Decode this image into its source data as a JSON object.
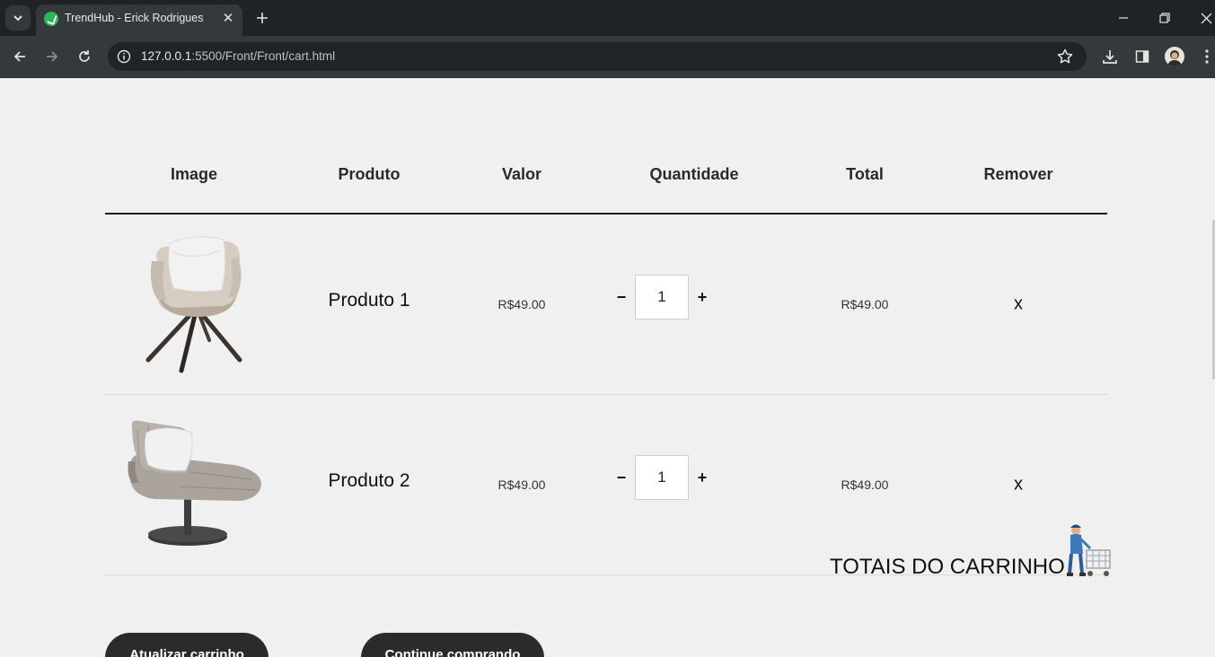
{
  "browser": {
    "tab_title": "TrendHub - Erick Rodrigues",
    "url_host": "127.0.0.1",
    "url_rest": ":5500/Front/Front/cart.html"
  },
  "table": {
    "headers": [
      "Image",
      "Produto",
      "Valor",
      "Quantidade",
      "Total",
      "Remover"
    ],
    "rows": [
      {
        "name": "Produto 1",
        "price": "R$49.00",
        "qty": "1",
        "total": "R$49.00",
        "remove": "x",
        "image": "armchair-image"
      },
      {
        "name": "Produto 2",
        "price": "R$49.00",
        "qty": "1",
        "total": "R$49.00",
        "remove": "x",
        "image": "lounge-chair-image"
      }
    ],
    "qty_minus": "−",
    "qty_plus": "+"
  },
  "actions": {
    "update_cart": "Atualizar carrinho",
    "continue_shopping": "Continue comprando"
  },
  "totals": {
    "title": "TOTAIS DO CARRINHO"
  }
}
